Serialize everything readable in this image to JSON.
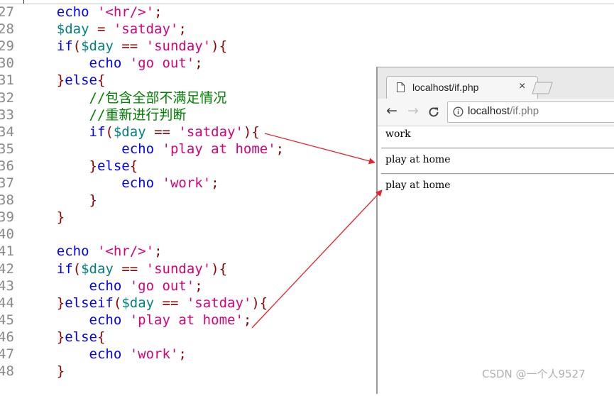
{
  "editor": {
    "lines": [
      {
        "n": "27",
        "tokens": [
          [
            "    ",
            ""
          ],
          [
            "echo",
            "kw"
          ],
          [
            " ",
            ""
          ],
          [
            "'<hr/>'",
            "str"
          ],
          [
            ";",
            "pun"
          ]
        ]
      },
      {
        "n": "28",
        "tokens": [
          [
            "    ",
            ""
          ],
          [
            "$day",
            "var"
          ],
          [
            " = ",
            "pun"
          ],
          [
            "'satday'",
            "str"
          ],
          [
            ";",
            "pun"
          ]
        ]
      },
      {
        "n": "29",
        "tokens": [
          [
            "    ",
            ""
          ],
          [
            "if",
            "kw"
          ],
          [
            "(",
            "pun"
          ],
          [
            "$day",
            "var"
          ],
          [
            " == ",
            "pun"
          ],
          [
            "'sunday'",
            "str"
          ],
          [
            "){",
            "pun"
          ]
        ]
      },
      {
        "n": "30",
        "tokens": [
          [
            "        ",
            ""
          ],
          [
            "echo",
            "kw"
          ],
          [
            " ",
            ""
          ],
          [
            "'go out'",
            "str"
          ],
          [
            ";",
            "pun"
          ]
        ]
      },
      {
        "n": "31",
        "tokens": [
          [
            "    ",
            ""
          ],
          [
            "}",
            "pun"
          ],
          [
            "else",
            "kw"
          ],
          [
            "{",
            "pun"
          ]
        ]
      },
      {
        "n": "32",
        "tokens": [
          [
            "        ",
            ""
          ],
          [
            "//包含全部不满足情况",
            "cmt"
          ]
        ]
      },
      {
        "n": "33",
        "tokens": [
          [
            "        ",
            ""
          ],
          [
            "//重新进行判断",
            "cmt"
          ]
        ]
      },
      {
        "n": "34",
        "tokens": [
          [
            "        ",
            ""
          ],
          [
            "if",
            "kw"
          ],
          [
            "(",
            "pun"
          ],
          [
            "$day",
            "var"
          ],
          [
            " == ",
            "pun"
          ],
          [
            "'satday'",
            "str"
          ],
          [
            "){",
            "pun"
          ]
        ]
      },
      {
        "n": "35",
        "tokens": [
          [
            "            ",
            ""
          ],
          [
            "echo",
            "kw"
          ],
          [
            " ",
            ""
          ],
          [
            "'play at home'",
            "str"
          ],
          [
            ";",
            "pun"
          ]
        ]
      },
      {
        "n": "36",
        "tokens": [
          [
            "        ",
            ""
          ],
          [
            "}",
            "pun"
          ],
          [
            "else",
            "kw"
          ],
          [
            "{",
            "pun"
          ]
        ]
      },
      {
        "n": "37",
        "tokens": [
          [
            "            ",
            ""
          ],
          [
            "echo",
            "kw"
          ],
          [
            " ",
            ""
          ],
          [
            "'work'",
            "str"
          ],
          [
            ";",
            "pun"
          ]
        ]
      },
      {
        "n": "38",
        "tokens": [
          [
            "        ",
            ""
          ],
          [
            "}",
            "pun"
          ]
        ]
      },
      {
        "n": "39",
        "tokens": [
          [
            "    ",
            ""
          ],
          [
            "}",
            "pun"
          ]
        ]
      },
      {
        "n": "40",
        "tokens": []
      },
      {
        "n": "41",
        "tokens": [
          [
            "    ",
            ""
          ],
          [
            "echo",
            "kw"
          ],
          [
            " ",
            ""
          ],
          [
            "'<hr/>'",
            "str"
          ],
          [
            ";",
            "pun"
          ]
        ]
      },
      {
        "n": "42",
        "tokens": [
          [
            "    ",
            ""
          ],
          [
            "if",
            "kw"
          ],
          [
            "(",
            "pun"
          ],
          [
            "$day",
            "var"
          ],
          [
            " == ",
            "pun"
          ],
          [
            "'sunday'",
            "str"
          ],
          [
            "){",
            "pun"
          ]
        ]
      },
      {
        "n": "43",
        "tokens": [
          [
            "        ",
            ""
          ],
          [
            "echo",
            "kw"
          ],
          [
            " ",
            ""
          ],
          [
            "'go out'",
            "str"
          ],
          [
            ";",
            "pun"
          ]
        ]
      },
      {
        "n": "44",
        "tokens": [
          [
            "    ",
            ""
          ],
          [
            "}",
            "pun"
          ],
          [
            "elseif",
            "kw"
          ],
          [
            "(",
            "pun"
          ],
          [
            "$day",
            "var"
          ],
          [
            " == ",
            "pun"
          ],
          [
            "'satday'",
            "str"
          ],
          [
            "){",
            "pun"
          ]
        ]
      },
      {
        "n": "45",
        "tokens": [
          [
            "        ",
            ""
          ],
          [
            "echo",
            "kw"
          ],
          [
            " ",
            ""
          ],
          [
            "'play at home'",
            "str"
          ],
          [
            ";",
            "pun"
          ]
        ]
      },
      {
        "n": "46",
        "tokens": [
          [
            "    ",
            ""
          ],
          [
            "}",
            "pun"
          ],
          [
            "else",
            "kw"
          ],
          [
            "{",
            "pun"
          ]
        ]
      },
      {
        "n": "47",
        "tokens": [
          [
            "        ",
            ""
          ],
          [
            "echo",
            "kw"
          ],
          [
            " ",
            ""
          ],
          [
            "'work'",
            "str"
          ],
          [
            ";",
            "pun"
          ]
        ]
      },
      {
        "n": "48",
        "tokens": [
          [
            "    ",
            ""
          ],
          [
            "}",
            "pun"
          ]
        ]
      }
    ]
  },
  "browser": {
    "tab_title": "localhost/if.php",
    "tab_close": "×",
    "back_icon": "←",
    "forward_icon": "→",
    "reload_icon": "C",
    "url_host": "localhost",
    "url_path": "/if.php",
    "output": [
      "work",
      "play at home",
      "play at home"
    ]
  },
  "annotation_color": "#e8202a",
  "watermark": "CSDN @一个人9527"
}
